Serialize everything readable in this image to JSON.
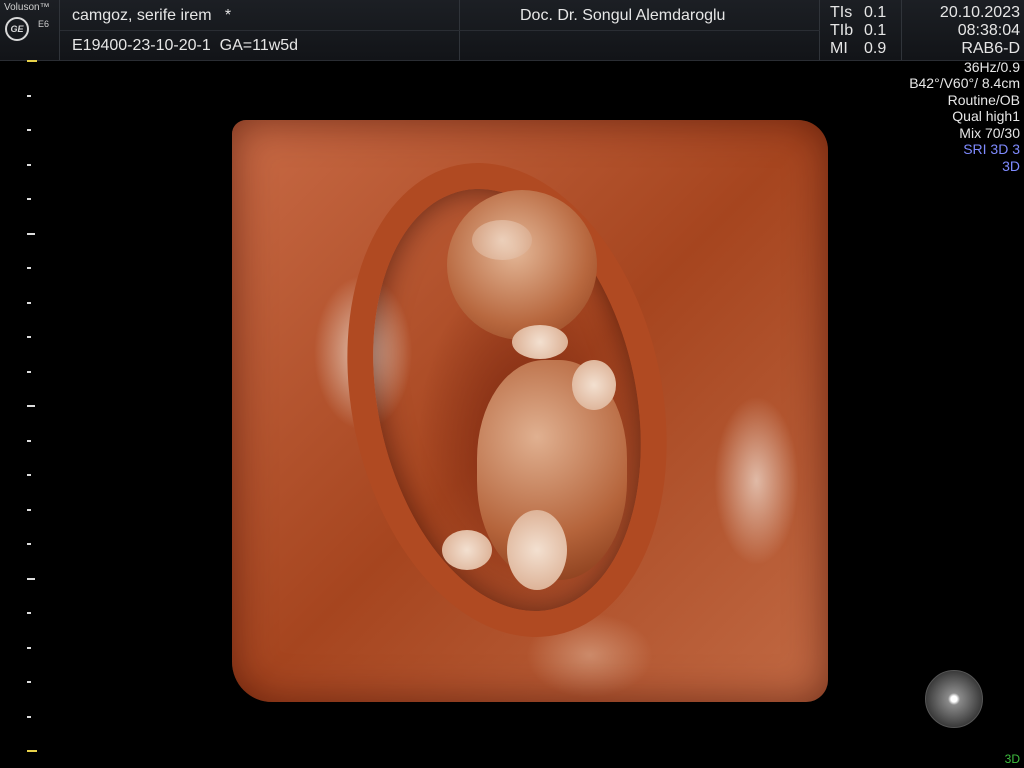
{
  "header": {
    "brand": "Voluson™",
    "model": "E6",
    "logo": "GE",
    "patient_name": "camgoz, serife irem   *",
    "patient_id": "E19400-23-10-20-1",
    "gestational_age": "GA=11w5d",
    "doctor": "Doc. Dr. Songul Alemdaroglu",
    "indices": [
      {
        "label": "TIs",
        "value": "0.1"
      },
      {
        "label": "TIb",
        "value": "0.1"
      },
      {
        "label": "MI",
        "value": "0.9"
      }
    ],
    "date": "20.10.2023",
    "time": "08:38:04",
    "probe": "RAB6-D"
  },
  "params": {
    "frame_rate": "36Hz/0.9",
    "angles_depth": "B42°/V60°/ 8.4cm",
    "preset": "Routine/OB",
    "quality": "Qual high1",
    "mix": "Mix 70/30",
    "sri": "SRI 3D 3",
    "mode": "3D"
  },
  "corner_label": "3D",
  "icons": {
    "orientation": "orientation-sphere-icon",
    "logo": "ge-logo-icon"
  },
  "colors": {
    "background": "#000000",
    "render_tone": "#b04a22",
    "highlight_blue": "#7f8bff",
    "depth_marker": "#e8d24a",
    "corner_label": "#3fbf3f"
  }
}
